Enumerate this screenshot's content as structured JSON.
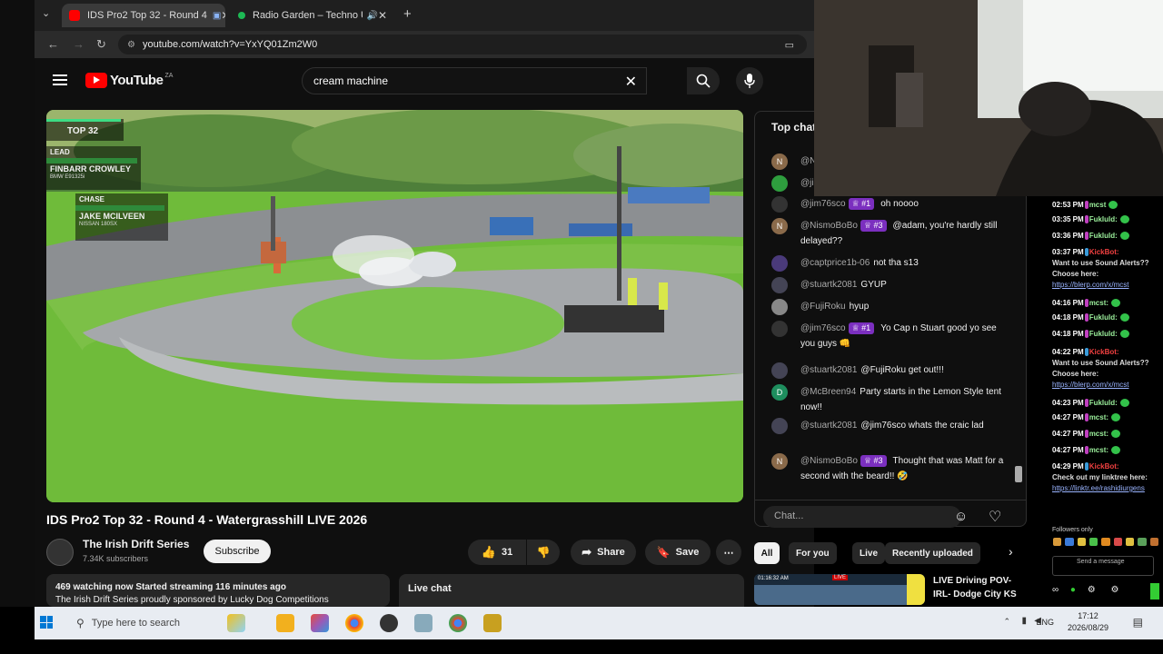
{
  "tabs": [
    {
      "label": "IDS Pro2 Top 32 - Round 4"
    },
    {
      "label": "Radio Garden – Techno Und"
    }
  ],
  "address": {
    "url": "youtube.com/watch?v=YxYQ01Zm2W0"
  },
  "youtube": {
    "logo": "YouTube",
    "region": "ZA",
    "search_value": "cream machine"
  },
  "overlay": {
    "top": "TOP 32",
    "lead_label": "LEAD",
    "lead_name": "FINBARR CROWLEY",
    "lead_car": "BMW E91325i",
    "chase_label": "CHASE",
    "chase_name": "JAKE MCILVEEN",
    "chase_car": "NISSAN 180SX"
  },
  "video": {
    "title": "IDS Pro2 Top 32 - Round 4 - Watergrasshill LIVE 2026",
    "channel": "The Irish Drift Series",
    "subscribers": "7.34K subscribers",
    "subscribe": "Subscribe",
    "likes": "31",
    "share": "Share",
    "save": "Save",
    "more": "⋯",
    "description": "469 watching now  Started streaming 116 minutes ago",
    "description2": "The Irish Drift Series proudly sponsored by Lucky Dog Competitions",
    "live_chat": "Live chat"
  },
  "chat": {
    "header": "Top chat",
    "placeholder": "Chat...",
    "messages": [
      {
        "av": "N",
        "avcolor": "#8a6a4a",
        "user": "@N",
        "badge": "",
        "text": ""
      },
      {
        "av": "",
        "avcolor": "#2e9e3e",
        "user": "@ji",
        "badge": "",
        "text": ""
      },
      {
        "av": "",
        "avcolor": "#333",
        "user": "@jim76sco",
        "badge": "♕ #1",
        "text": "oh noooo"
      },
      {
        "av": "N",
        "avcolor": "#8a6a4a",
        "user": "@NismoBoBo",
        "badge": "♕ #3",
        "text": "@adam, you're hardly still delayed??"
      },
      {
        "av": "",
        "avcolor": "#4a3a7a",
        "user": "@captprice1b-06",
        "badge": "",
        "text": "not tha s13"
      },
      {
        "av": "",
        "avcolor": "#445",
        "user": "@stuartk2081",
        "badge": "",
        "text": "GYUP"
      },
      {
        "av": "",
        "avcolor": "#888",
        "user": "@FujiRoku",
        "badge": "",
        "text": "hyup"
      },
      {
        "av": "",
        "avcolor": "#333",
        "user": "@jim76sco",
        "badge": "♕ #1",
        "text": "Yo Cap n Stuart good yo see you guys 👊"
      },
      {
        "av": "",
        "avcolor": "#445",
        "user": "@stuartk2081",
        "badge": "",
        "text": "@FujiRoku get out!!!"
      },
      {
        "av": "D",
        "avcolor": "#1e8e5e",
        "user": "@McBreen94",
        "badge": "",
        "text": "Party starts in the Lemon Style tent now!!"
      },
      {
        "av": "",
        "avcolor": "#445",
        "user": "@stuartk2081",
        "badge": "",
        "text": "@jim76sco whats the craic lad"
      },
      {
        "av": "N",
        "avcolor": "#8a6a4a",
        "user": "@NismoBoBo",
        "badge": "♕ #3",
        "text": "Thought that was Matt for a second with the beard!! 🤣"
      }
    ]
  },
  "filters": [
    "All",
    "For you",
    "Live",
    "Recently uploaded"
  ],
  "recommended": {
    "title": "LIVE Driving POV- IRL- Dodge City KS",
    "thumb_time": "01:16:32 AM",
    "thumb_badge": "LIVE"
  },
  "stream_chat": {
    "lines": [
      {
        "time": "02:53 PM",
        "name": "mcst",
        "type": "user",
        "msg": ""
      },
      {
        "time": "03:35 PM",
        "name": "Fukluld:",
        "type": "user",
        "msg": ""
      },
      {
        "time": "03:36 PM",
        "name": "Fukluld:",
        "type": "user",
        "msg": ""
      },
      {
        "time": "03:37 PM",
        "name": "KickBot:",
        "type": "bot",
        "msg": "Want to use Sound Alerts?? Choose here:",
        "link": "https://blerp.com/x/mcst"
      },
      {
        "time": "04:16 PM",
        "name": "mcst:",
        "type": "user",
        "msg": ""
      },
      {
        "time": "04:18 PM",
        "name": "Fukluld:",
        "type": "user",
        "msg": ""
      },
      {
        "time": "04:18 PM",
        "name": "Fukluld:",
        "type": "user",
        "msg": ""
      },
      {
        "time": "04:22 PM",
        "name": "KickBot:",
        "type": "bot",
        "msg": "Want to use Sound Alerts?? Choose here:",
        "link": "https://blerp.com/x/mcst"
      },
      {
        "time": "04:23 PM",
        "name": "Fukluld:",
        "type": "user",
        "msg": ""
      },
      {
        "time": "04:27 PM",
        "name": "mcst:",
        "type": "user",
        "msg": ""
      },
      {
        "time": "04:27 PM",
        "name": "mcst:",
        "type": "user",
        "msg": ""
      },
      {
        "time": "04:27 PM",
        "name": "mcst:",
        "type": "user",
        "msg": ""
      },
      {
        "time": "04:29 PM",
        "name": "KickBot:",
        "type": "bot",
        "msg": "Check out my linktree here:",
        "link": "https://linktr.ee/rashidiurgens"
      }
    ],
    "followers_only": "Followers only",
    "send_placeholder": "Send a message"
  },
  "taskbar": {
    "search": "Type here to search",
    "lang": "ENG",
    "time": "17:12",
    "date": "2026/08/29"
  }
}
